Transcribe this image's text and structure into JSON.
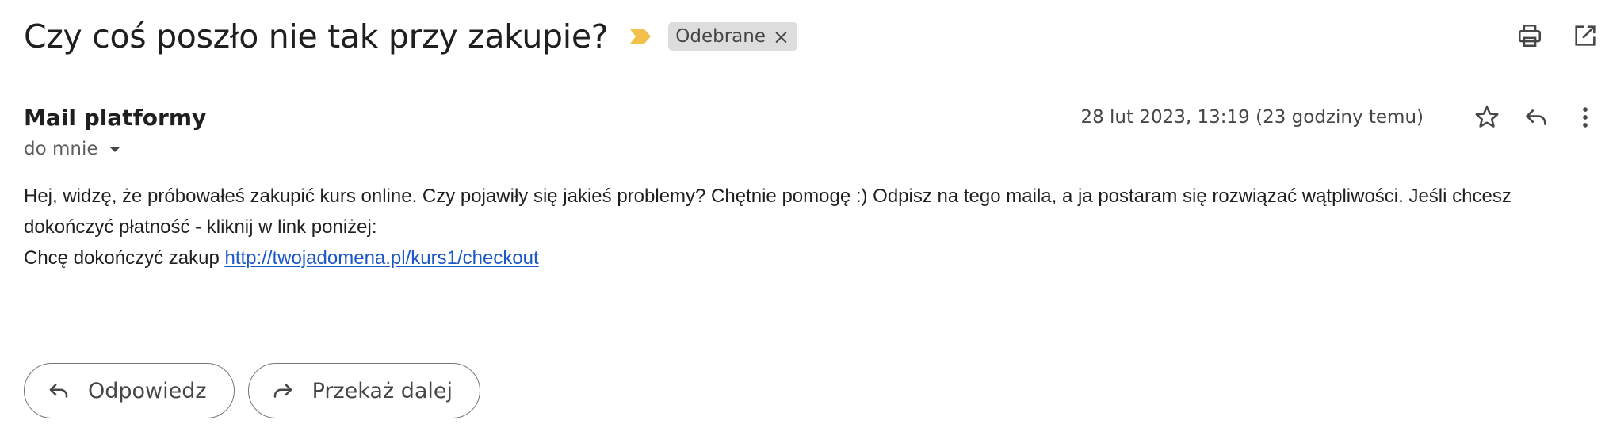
{
  "email": {
    "subject": "Czy coś poszło nie tak przy zakupie?",
    "label": "Odebrane",
    "label_remove": "×",
    "sender": "Mail platformy",
    "recipient": "do mnie",
    "date": "28 lut 2023, 13:19 (23 godziny temu)",
    "body_line1": "Hej, widzę, że próbowałeś zakupić kurs online. Czy pojawiły się jakieś problemy? Chętnie pomogę :) Odpisz na tego maila, a ja postaram się rozwiązać wątpliwości. Jeśli chcesz dokończyć płatność - kliknij w link poniżej:",
    "body_line2_prefix": "Chcę dokończyć zakup",
    "link_text": "http://twojadomena.pl/kurs1/checkout"
  },
  "actions": {
    "reply_label": "Odpowiedz",
    "forward_label": "Przekaż dalej"
  },
  "icons": {
    "importance": "importance-marker-icon",
    "print": "print-icon",
    "open_new_window": "open-in-new-window-icon",
    "star": "star-icon",
    "reply": "reply-icon",
    "more": "more-vert-icon",
    "reply_small": "reply-icon",
    "forward": "forward-icon"
  },
  "colors": {
    "importance": "#f2c14b",
    "label_bg": "#dddddd",
    "link": "#1a57c9"
  }
}
